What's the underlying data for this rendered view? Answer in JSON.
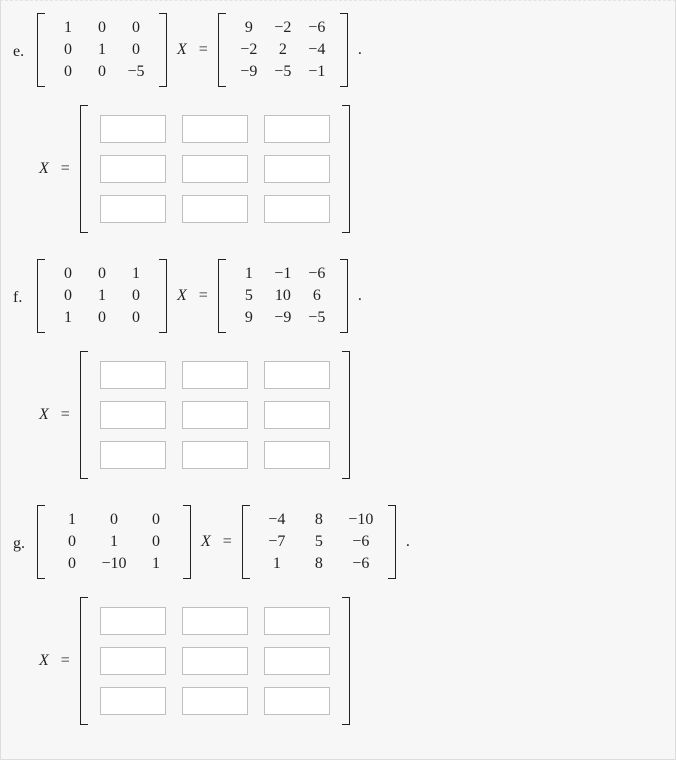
{
  "symbols": {
    "X": "X",
    "eq": "=",
    "dot": "."
  },
  "problems": [
    {
      "label": "e.",
      "A": [
        [
          "1",
          "0",
          "0"
        ],
        [
          "0",
          "1",
          "0"
        ],
        [
          "0",
          "0",
          "−5"
        ]
      ],
      "B": [
        [
          "9",
          "−2",
          "−6"
        ],
        [
          "−2",
          "2",
          "−4"
        ],
        [
          "−9",
          "−5",
          "−1"
        ]
      ],
      "wide_B": false,
      "wide_A": false
    },
    {
      "label": "f.",
      "A": [
        [
          "0",
          "0",
          "1"
        ],
        [
          "0",
          "1",
          "0"
        ],
        [
          "1",
          "0",
          "0"
        ]
      ],
      "B": [
        [
          "1",
          "−1",
          "−6"
        ],
        [
          "5",
          "10",
          "6"
        ],
        [
          "9",
          "−9",
          "−5"
        ]
      ],
      "wide_B": false,
      "wide_A": false
    },
    {
      "label": "g.",
      "A": [
        [
          "1",
          "0",
          "0"
        ],
        [
          "0",
          "1",
          "0"
        ],
        [
          "0",
          "−10",
          "1"
        ]
      ],
      "B": [
        [
          "−4",
          "8",
          "−10"
        ],
        [
          "−7",
          "5",
          "−6"
        ],
        [
          "1",
          "8",
          "−6"
        ]
      ],
      "wide_B": true,
      "wide_A": true
    }
  ]
}
